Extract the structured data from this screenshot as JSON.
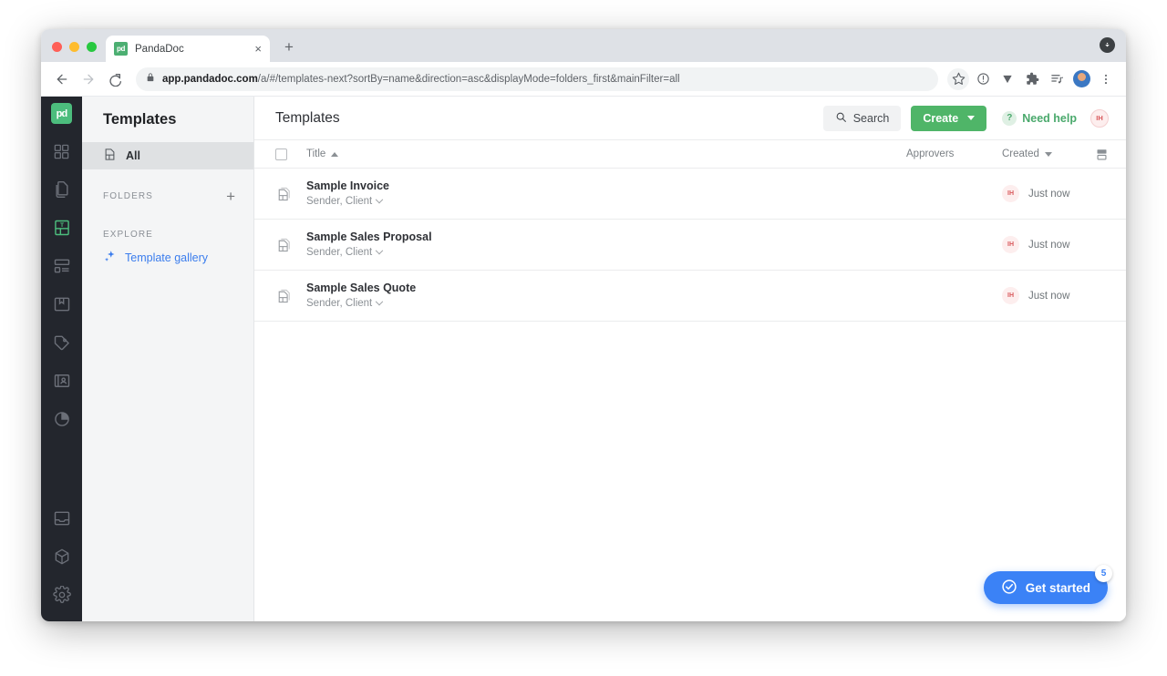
{
  "browser": {
    "tab": {
      "title": "PandaDoc",
      "favicon_label": "pd",
      "close_icon": "×"
    },
    "new_tab_icon": "+",
    "nav": {
      "back_icon": "←",
      "forward_icon": "→",
      "reload_icon": "⟳"
    },
    "address": {
      "lock_icon": "lock-icon",
      "url_bold": "app.pandadoc.com",
      "url_rest": "/a/#/templates-next?sortBy=name&direction=asc&displayMode=folders_first&mainFilter=all",
      "full_url": "app.pandadoc.com/a/#/templates-next?sortBy=name&direction=asc&displayMode=folders_first&mainFilter=all"
    },
    "toolbar_icons": [
      "star-icon",
      "info-circle-icon",
      "triangle-down-icon",
      "extensions-puzzle-icon",
      "reading-list-icon",
      "profile-avatar",
      "chrome-menu-icon"
    ]
  },
  "rail": {
    "logo_label": "pd",
    "items": [
      {
        "name": "dashboard",
        "active": false
      },
      {
        "name": "documents",
        "active": false
      },
      {
        "name": "templates",
        "active": true
      },
      {
        "name": "forms",
        "active": false
      },
      {
        "name": "content-library",
        "active": false
      },
      {
        "name": "catalog",
        "active": false
      },
      {
        "name": "contacts",
        "active": false
      },
      {
        "name": "reports",
        "active": false
      }
    ],
    "bottom_items": [
      {
        "name": "inbox"
      },
      {
        "name": "integrations"
      },
      {
        "name": "settings"
      }
    ]
  },
  "sidebar": {
    "title": "Templates",
    "all_item": {
      "label": "All"
    },
    "folders_section": {
      "label": "Folders",
      "add_icon": "+"
    },
    "explore_section": {
      "label": "Explore"
    },
    "template_gallery": {
      "label": "Template gallery"
    }
  },
  "main": {
    "title": "Templates",
    "search_button": "Search",
    "create_button": "Create",
    "need_help": "Need help",
    "help_glyph": "?",
    "avatar_initials": "IH",
    "columns": {
      "title": "Title",
      "approvers": "Approvers",
      "created": "Created"
    },
    "sort": {
      "column": "Title",
      "direction": "asc"
    },
    "rows": [
      {
        "title": "Sample Invoice",
        "roles": "Sender, Client",
        "approvers": "",
        "created_by": "IH",
        "created": "Just now"
      },
      {
        "title": "Sample Sales Proposal",
        "roles": "Sender, Client",
        "approvers": "",
        "created_by": "IH",
        "created": "Just now"
      },
      {
        "title": "Sample Sales Quote",
        "roles": "Sender, Client",
        "approvers": "",
        "created_by": "IH",
        "created": "Just now"
      }
    ]
  },
  "get_started": {
    "label": "Get started",
    "badge": "5"
  },
  "colors": {
    "brand_green": "#4fb568",
    "link_blue": "#3b7ded",
    "get_started_blue": "#3b82f6",
    "avatar_red": "#d8575a",
    "rail_dark": "#23262d"
  }
}
